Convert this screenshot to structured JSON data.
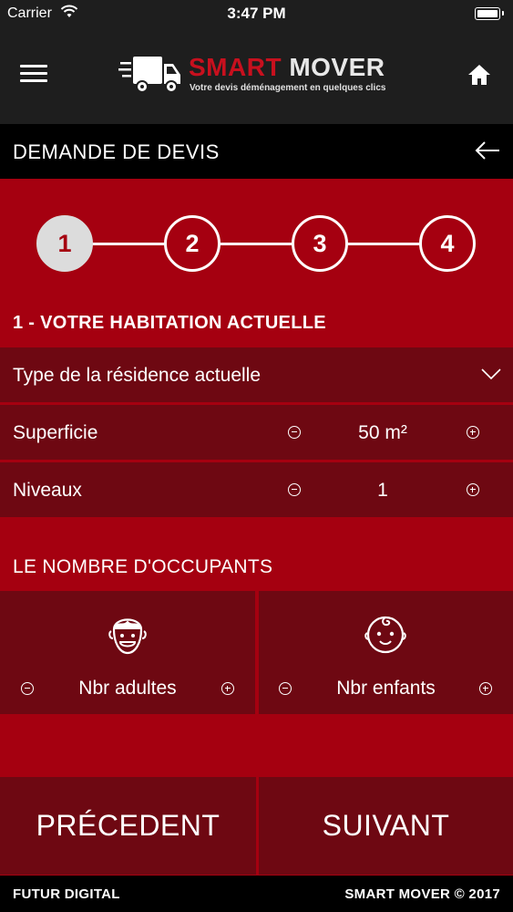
{
  "status_bar": {
    "carrier": "Carrier",
    "time": "3:47 PM"
  },
  "header": {
    "brand_red": "SMART",
    "brand_white": " MOVER",
    "tagline": "Votre devis déménagement en quelques clics",
    "menu_icon": "hamburger-icon",
    "home_icon": "home-icon"
  },
  "title_bar": {
    "title": "DEMANDE DE DEVIS",
    "back_icon": "arrow-left-icon"
  },
  "stepper": {
    "steps": [
      "1",
      "2",
      "3",
      "4"
    ],
    "active_step": "1"
  },
  "section1": {
    "title": "1 - VOTRE HABITATION ACTUELLE",
    "residence_type": {
      "label": "Type de la résidence actuelle"
    },
    "superficie": {
      "label": "Superficie",
      "value": "50 m²"
    },
    "niveaux": {
      "label": "Niveaux",
      "value": "1"
    }
  },
  "section2": {
    "title": "LE NOMBRE D'OCCUPANTS",
    "adults": {
      "label": "Nbr adultes",
      "icon": "adult-face-icon"
    },
    "children": {
      "label": "Nbr enfants",
      "icon": "baby-face-icon"
    }
  },
  "navigation": {
    "previous": "PRÉCEDENT",
    "next": "SUIVANT"
  },
  "footer": {
    "left": "FUTUR DIGITAL",
    "right": "SMART MOVER © 2017"
  },
  "colors": {
    "background_red": "#a50010",
    "row_dark_red": "#6e0812",
    "header_dark": "#1e1e1e",
    "black": "#000000"
  }
}
